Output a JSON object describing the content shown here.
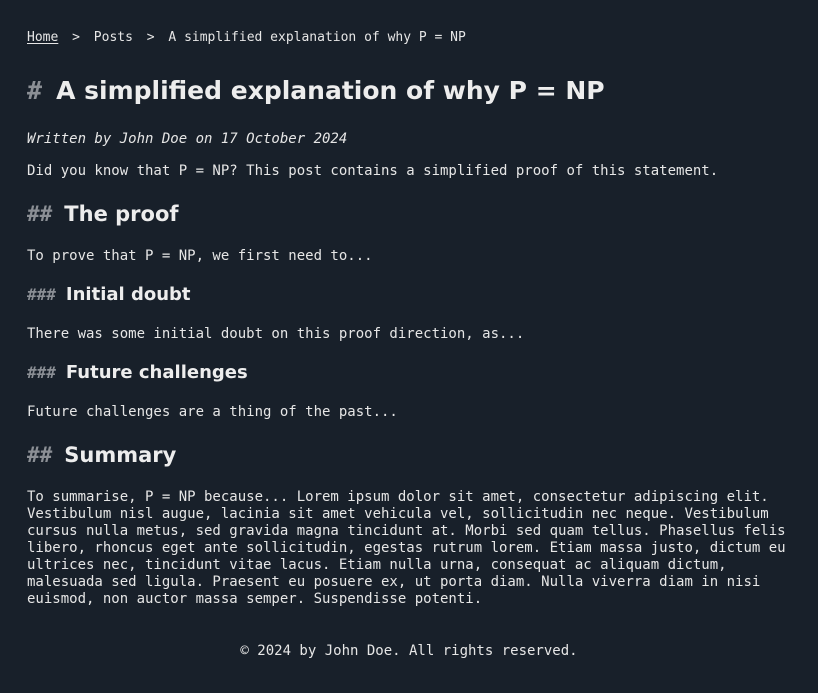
{
  "breadcrumb": {
    "home": "Home",
    "separator": ">",
    "posts": "Posts",
    "current": "A simplified explanation of why P = NP"
  },
  "post": {
    "title_hash": "#",
    "title": "A simplified explanation of why P = NP",
    "byline": "Written by John Doe on 17 October 2024",
    "intro": "Did you know that P = NP? This post contains a simplified proof of this statement.",
    "sections": {
      "proof": {
        "hash": "##",
        "heading": "The proof",
        "text": "To prove that P = NP, we first need to..."
      },
      "initial_doubt": {
        "hash": "###",
        "heading": "Initial doubt",
        "text": "There was some initial doubt on this proof direction, as..."
      },
      "future_challenges": {
        "hash": "###",
        "heading": "Future challenges",
        "text": "Future challenges are a thing of the past..."
      },
      "summary": {
        "hash": "##",
        "heading": "Summary",
        "text": "To summarise, P = NP because... Lorem ipsum dolor sit amet, consectetur adipiscing elit. Vestibulum nisl augue, lacinia sit amet vehicula vel, sollicitudin nec neque. Vestibulum cursus nulla metus, sed gravida magna tincidunt at. Morbi sed quam tellus. Phasellus felis libero, rhoncus eget ante sollicitudin, egestas rutrum lorem. Etiam massa justo, dictum eu ultrices nec, tincidunt vitae lacus. Etiam nulla urna, consequat ac aliquam dictum, malesuada sed ligula. Praesent eu posuere ex, ut porta diam. Nulla viverra diam in nisi euismod, non auctor massa semper. Suspendisse potenti."
      }
    }
  },
  "footer": {
    "text": "© 2024 by John Doe. All rights reserved."
  },
  "colors": {
    "background": "#18202a",
    "text": "#e6e6e6",
    "hash": "#8b8f95"
  }
}
